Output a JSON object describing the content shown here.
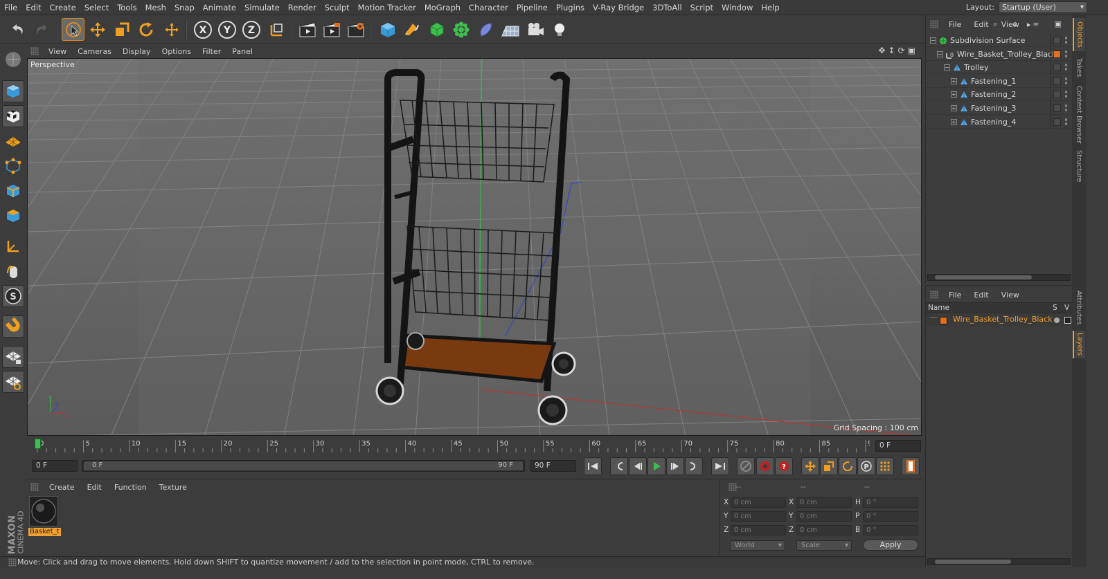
{
  "menubar": {
    "items": [
      "File",
      "Edit",
      "Create",
      "Select",
      "Tools",
      "Mesh",
      "Snap",
      "Animate",
      "Simulate",
      "Render",
      "Sculpt",
      "Motion Tracker",
      "MoGraph",
      "Character",
      "Pipeline",
      "Plugins",
      "V-Ray Bridge",
      "3DToAll",
      "Script",
      "Window",
      "Help"
    ],
    "layout_label": "Layout:",
    "layout_value": "Startup (User)"
  },
  "toolbar": {
    "icons": [
      "undo-icon",
      "redo-icon",
      "live-selection-icon",
      "move-icon",
      "scale-icon",
      "rotate-icon",
      "recent-tool-icon",
      "x-axis-icon",
      "y-axis-icon",
      "z-axis-icon",
      "coordinate-system-icon",
      "render-view-icon",
      "render-picture-viewer-icon",
      "render-settings-icon",
      "cube-icon",
      "pen-icon",
      "subdivision-icon",
      "cloner-icon",
      "deformer-icon",
      "floor-icon",
      "camera-icon",
      "light-icon"
    ],
    "axis_labels": {
      "x": "X",
      "y": "Y",
      "z": "Z"
    }
  },
  "viewport": {
    "menus": [
      "View",
      "Cameras",
      "Display",
      "Options",
      "Filter",
      "Panel"
    ],
    "label": "Perspective",
    "grid_spacing": "Grid Spacing : 100 cm"
  },
  "timeline": {
    "ticks": [
      "0",
      "5",
      "10",
      "15",
      "20",
      "25",
      "30",
      "35",
      "40",
      "45",
      "50",
      "55",
      "60",
      "65",
      "70",
      "75",
      "80",
      "85",
      "90"
    ],
    "current_frame_display": "0 F"
  },
  "transport": {
    "start": "0 F",
    "range_left": "0 F",
    "range_right": "90 F",
    "end": "90 F"
  },
  "material_panel": {
    "menus": [
      "Create",
      "Edit",
      "Function",
      "Texture"
    ],
    "material_name": "Basket_t",
    "brand": "MAXON",
    "product": "CINEMA 4D"
  },
  "coord_panel": {
    "col_headers": [
      "--",
      "--",
      "--"
    ],
    "rows": [
      {
        "a": "X",
        "av": "0 cm",
        "b": "X",
        "bv": "0 cm",
        "c": "H",
        "cv": "0 °"
      },
      {
        "a": "Y",
        "av": "0 cm",
        "b": "Y",
        "bv": "0 cm",
        "c": "P",
        "cv": "0 °"
      },
      {
        "a": "Z",
        "av": "0 cm",
        "b": "Z",
        "bv": "0 cm",
        "c": "B",
        "cv": "0 °"
      }
    ],
    "space": "World",
    "mode": "Scale",
    "apply": "Apply"
  },
  "status": "Move: Click and drag to move elements. Hold down SHIFT to quantize movement / add to the selection in point mode, CTRL to remove.",
  "objects_panel": {
    "menus": [
      "File",
      "Edit",
      "View"
    ],
    "items": [
      {
        "name": "Subdivision Surface",
        "indent": 0
      },
      {
        "name": "Wire_Basket_Trolley_Black",
        "indent": 1
      },
      {
        "name": "Trolley",
        "indent": 2
      },
      {
        "name": "Fastening_1",
        "indent": 3
      },
      {
        "name": "Fastening_2",
        "indent": 3
      },
      {
        "name": "Fastening_3",
        "indent": 3
      },
      {
        "name": "Fastening_4",
        "indent": 3
      }
    ]
  },
  "layers_panel": {
    "menus": [
      "File",
      "Edit",
      "View"
    ],
    "col_name": "Name",
    "col_s": "S",
    "col_v": "V",
    "layer_name": "Wire_Basket_Trolley_Black"
  },
  "right_tabs": [
    "Objects",
    "Takes",
    "Content Browser",
    "Structure",
    "Attributes",
    "Layers"
  ],
  "colors": {
    "accent": "#e08a1a",
    "layer": "#e07020",
    "selected_text": "#f0a030"
  }
}
